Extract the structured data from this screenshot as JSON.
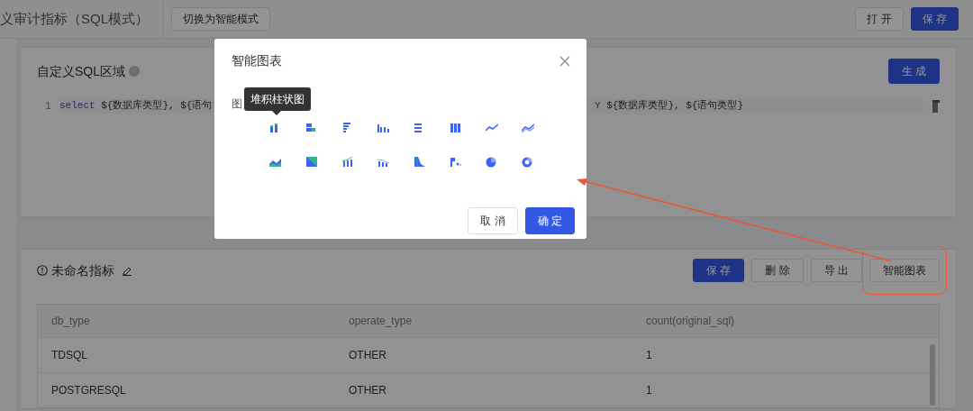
{
  "page": {
    "title": "义审计指标（SQL模式）",
    "mode_button": "切换为智能模式",
    "buttons": [
      {
        "label": "打 开",
        "kind": "default"
      },
      {
        "label": "保 存",
        "kind": "primary"
      }
    ]
  },
  "sql_card": {
    "title": "自定义SQL区域",
    "button": "生 成",
    "line_number": "1",
    "code_start": [
      {
        "text": "select",
        "kind": "keyword"
      },
      {
        "text": " ${数据库类型}, ${语句",
        "kind": "plain"
      }
    ],
    "code_end": [
      {
        "text": "Y",
        "kind": "keyword"
      },
      {
        "text": " ${数据库类型}, ${语句类型}",
        "kind": "plain"
      }
    ]
  },
  "metric_card": {
    "title": "未命名指标",
    "buttons": [
      {
        "label": "保 存",
        "kind": "primary",
        "highlighted": false
      },
      {
        "label": "删 除",
        "kind": "default",
        "highlighted": false
      },
      {
        "label": "导 出",
        "kind": "default",
        "highlighted": false
      },
      {
        "label": "智能图表",
        "kind": "default",
        "highlighted": true
      }
    ],
    "table": {
      "columns": [
        "db_type",
        "operate_type",
        "count(original_sql)"
      ],
      "rows": [
        [
          "TDSQL",
          "OTHER",
          "1"
        ],
        [
          "POSTGRESQL",
          "OTHER",
          "1"
        ]
      ]
    }
  },
  "dialog": {
    "title": "智能图表",
    "field_label": "图",
    "tooltip": "堆积柱状图",
    "buttons": [
      {
        "label": "取 消",
        "kind": "default"
      },
      {
        "label": "确 定",
        "kind": "primary"
      }
    ]
  }
}
